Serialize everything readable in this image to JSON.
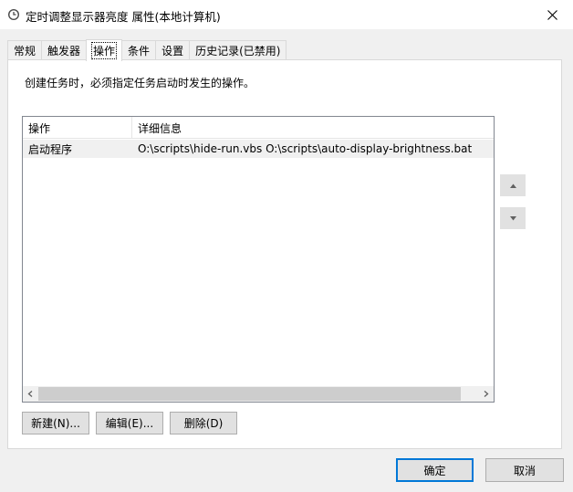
{
  "window": {
    "title": "定时调整显示器亮度 属性(本地计算机)",
    "icon": "task-clock-icon"
  },
  "tabs": [
    {
      "label": "常规",
      "active": false
    },
    {
      "label": "触发器",
      "active": false
    },
    {
      "label": "操作",
      "active": true
    },
    {
      "label": "条件",
      "active": false
    },
    {
      "label": "设置",
      "active": false
    },
    {
      "label": "历史记录(已禁用)",
      "active": false
    }
  ],
  "actions_panel": {
    "description": "创建任务时，必须指定任务启动时发生的操作。",
    "columns": [
      "操作",
      "详细信息"
    ],
    "rows": [
      {
        "action": "启动程序",
        "details": "O:\\scripts\\hide-run.vbs O:\\scripts\\auto-display-brightness.bat",
        "selected": true
      }
    ],
    "move_up_icon": "triangle-up-icon",
    "move_down_icon": "triangle-down-icon",
    "buttons": {
      "new_label": "新建(N)...",
      "edit_label": "编辑(E)...",
      "delete_label": "删除(D)"
    }
  },
  "footer": {
    "ok_label": "确定",
    "cancel_label": "取消"
  },
  "colors": {
    "window_bg": "#f0f0f0",
    "panel_bg": "#ffffff",
    "default_button_border": "#0078d7"
  }
}
